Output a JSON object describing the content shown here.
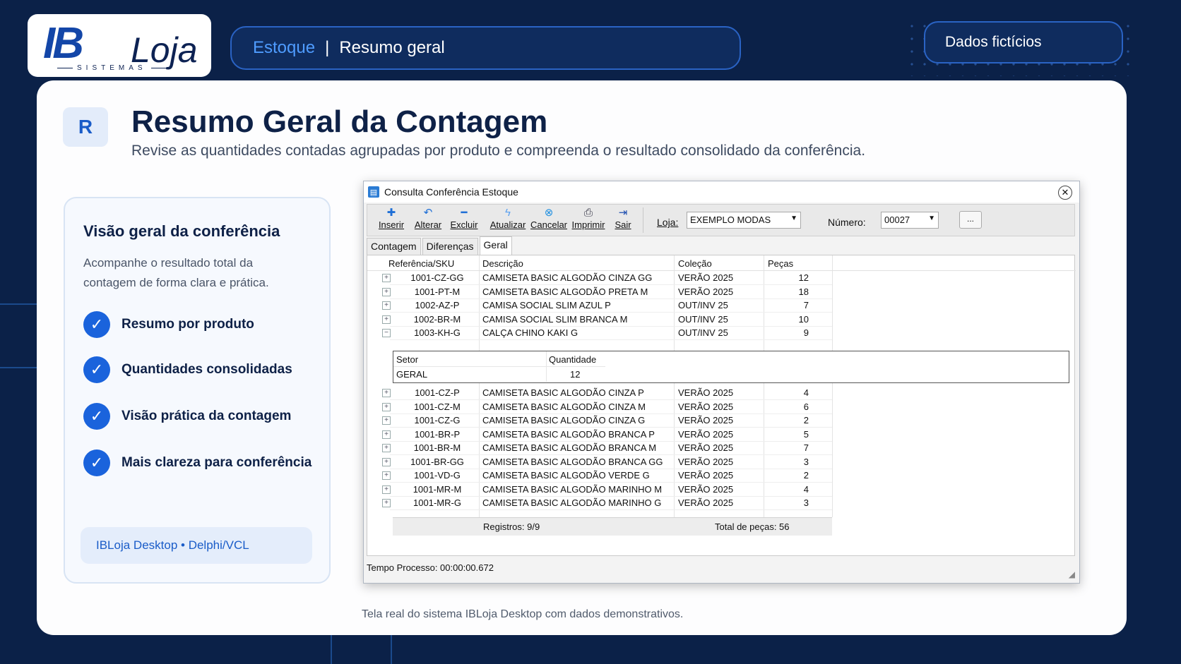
{
  "brand": {
    "main": "IB",
    "sub": "Loja",
    "tagline": "SISTEMAS"
  },
  "breadcrumb": {
    "section": "Estoque",
    "separator": "|",
    "page": "Resumo geral"
  },
  "badge_pill": "Dados fictícios",
  "header": {
    "letter": "R",
    "title": "Resumo Geral da Contagem",
    "subtitle": "Revise as quantidades contadas agrupadas por produto e compreenda o resultado consolidado da conferência."
  },
  "sidebar": {
    "title": "Visão geral da conferência",
    "description": "Acompanhe o resultado total da contagem de forma clara e prática.",
    "features": [
      "Resumo por produto",
      "Quantidades consolidadas",
      "Visão prática da contagem",
      "Mais clareza para conferência"
    ],
    "footer": "IBLoja Desktop • Delphi/VCL"
  },
  "caption": "Tela real do sistema IBLoja Desktop com dados demonstrativos.",
  "window": {
    "title": "Consulta Conferência Estoque",
    "toolbar": [
      "Inserir",
      "Alterar",
      "Excluir",
      "Atualizar",
      "Cancelar",
      "Imprimir",
      "Sair"
    ],
    "loja_label": "Loja:",
    "loja_value": "EXEMPLO MODAS",
    "numero_label": "Número:",
    "numero_value": "00027",
    "more_button": "...",
    "tabs": [
      "Contagem",
      "Diferenças",
      "Geral"
    ],
    "active_tab": "Geral",
    "columns": [
      "Referência/SKU",
      "Descrição",
      "Coleção",
      "Peças"
    ],
    "rows_top": [
      [
        "1001-CZ-GG",
        "CAMISETA BASIC ALGODÃO CINZA GG",
        "VERÃO 2025",
        "12"
      ],
      [
        "1001-PT-M",
        "CAMISETA BASIC ALGODÃO PRETA M",
        "VERÃO 2025",
        "18"
      ],
      [
        "1002-AZ-P",
        "CAMISA SOCIAL SLIM AZUL P",
        "OUT/INV 25",
        "7"
      ],
      [
        "1002-BR-M",
        "CAMISA SOCIAL SLIM BRANCA M",
        "OUT/INV 25",
        "10"
      ],
      [
        "1003-KH-G",
        "CALÇA CHINO KAKI G",
        "OUT/INV 25",
        "9"
      ]
    ],
    "detail": {
      "col_setor": "Setor",
      "col_quantidade": "Quantidade",
      "setor": "GERAL",
      "quantidade": "12"
    },
    "rows_bottom": [
      [
        "1001-CZ-P",
        "CAMISETA BASIC ALGODÃO CINZA P",
        "VERÃO 2025",
        "4"
      ],
      [
        "1001-CZ-M",
        "CAMISETA BASIC ALGODÃO CINZA M",
        "VERÃO 2025",
        "6"
      ],
      [
        "1001-CZ-G",
        "CAMISETA BASIC ALGODÃO CINZA G",
        "VERÃO 2025",
        "2"
      ],
      [
        "1001-BR-P",
        "CAMISETA BASIC ALGODÃO BRANCA P",
        "VERÃO 2025",
        "5"
      ],
      [
        "1001-BR-M",
        "CAMISETA BASIC ALGODÃO BRANCA M",
        "VERÃO 2025",
        "7"
      ],
      [
        "1001-BR-GG",
        "CAMISETA BASIC ALGODÃO BRANCA GG",
        "VERÃO 2025",
        "3"
      ],
      [
        "1001-VD-G",
        "CAMISETA BASIC ALGODÃO VERDE G",
        "VERÃO 2025",
        "2"
      ],
      [
        "1001-MR-M",
        "CAMISETA BASIC ALGODÃO MARINHO M",
        "VERÃO 2025",
        "4"
      ],
      [
        "1001-MR-G",
        "CAMISETA BASIC ALGODÃO MARINHO G",
        "VERÃO 2025",
        "3"
      ]
    ],
    "footer_registros": "Registros: 9/9",
    "footer_total": "Total de peças:  56",
    "status": "Tempo Processo: 00:00:00.672"
  },
  "colors": {
    "background": "#0b2148",
    "accent": "#1a63dc",
    "link": "#4f9cff"
  }
}
